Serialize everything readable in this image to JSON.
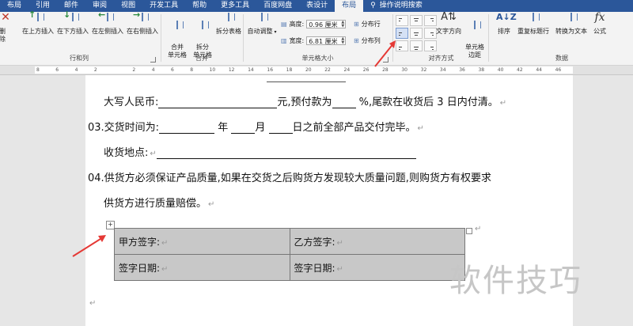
{
  "tabs": [
    {
      "label": "布局",
      "active": false
    },
    {
      "label": "引用",
      "active": false
    },
    {
      "label": "邮件",
      "active": false
    },
    {
      "label": "审阅",
      "active": false
    },
    {
      "label": "视图",
      "active": false
    },
    {
      "label": "开发工具",
      "active": false
    },
    {
      "label": "帮助",
      "active": false
    },
    {
      "label": "更多工具",
      "active": false
    },
    {
      "label": "百度网盘",
      "active": false
    },
    {
      "label": "表设计",
      "active": false
    },
    {
      "label": "布局",
      "active": true
    }
  ],
  "tellme": "操作说明搜索",
  "ribbon": {
    "rows_cols": {
      "label": "行和列",
      "delete": "删除",
      "insert_above": "在上方插入",
      "insert_below": "在下方插入",
      "insert_left": "在左侧插入",
      "insert_right": "在右侧插入"
    },
    "merge": {
      "label": "合并",
      "merge_cells": "合并\n单元格",
      "split_cells": "拆分\n单元格",
      "split_table": "拆分表格"
    },
    "cell_size": {
      "label": "单元格大小",
      "autofit": "自动调整",
      "height_label": "高度:",
      "height_value": "0.96 厘米",
      "width_label": "宽度:",
      "width_value": "6.81 厘米",
      "dist_rows": "分布行",
      "dist_cols": "分布列"
    },
    "alignment": {
      "label": "对齐方式",
      "text_direction": "文字方向",
      "cell_margins": "单元格\n边距"
    },
    "data": {
      "label": "数据",
      "sort": "排序",
      "repeat_header": "重复标题行",
      "to_text": "转换为文本",
      "formula": "公式",
      "formula_icon": "fx"
    }
  },
  "ruler_ticks": [
    "8",
    "6",
    "4",
    "2",
    "",
    "2",
    "4",
    "6",
    "8",
    "10",
    "12",
    "14",
    "16",
    "18",
    "20",
    "22",
    "24",
    "26",
    "28",
    "30",
    "32",
    "34",
    "36",
    "38",
    "40",
    "42",
    "44",
    "46"
  ],
  "document": {
    "line1_prefix": "大写人民币:",
    "line1_mid": "元,预付款为",
    "line1_suffix": "%,尾款在收货后 3 日内付清。",
    "line2_prefix": "03.交货时间为:",
    "line2_year": "年",
    "line2_month": "月",
    "line2_suffix": "日之前全部产品交付完毕。",
    "line3_prefix": "收货地点:",
    "line4": "04.供货方必须保证产品质量,如果在交货之后购货方发现较大质量问题,则购货方有权要求",
    "line5": "供货方进行质量赔偿。",
    "para_mark": "↵",
    "move_handle": "+",
    "table": [
      [
        "甲方签字:",
        "乙方签字:"
      ],
      [
        "签字日期:",
        "签字日期:"
      ]
    ]
  },
  "watermark": "软件技巧",
  "colors": {
    "brand": "#2b579a",
    "annotation_arrow": "#e53935",
    "table_shade": "#c8c8c8"
  }
}
